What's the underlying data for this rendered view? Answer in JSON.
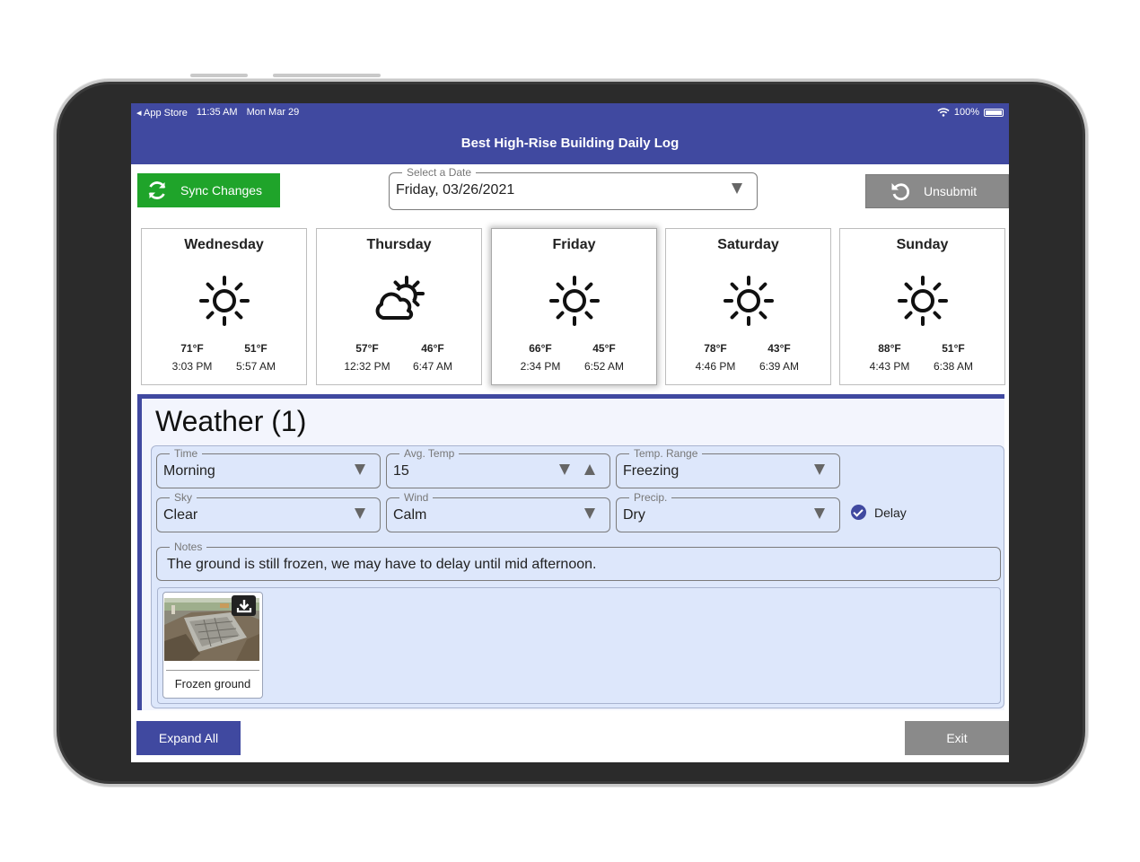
{
  "status_bar": {
    "back_app": "App Store",
    "time": "11:35 AM",
    "date": "Mon Mar 29",
    "battery": "100%"
  },
  "header": {
    "title": "Best High-Rise Building Daily Log"
  },
  "toolbar": {
    "sync_label": "Sync Changes",
    "unsubmit_label": "Unsubmit",
    "date_select": {
      "label": "Select a Date",
      "value": "Friday, 03/26/2021"
    }
  },
  "days": [
    {
      "name": "Wednesday",
      "icon": "sun-icon",
      "high": "71°F",
      "high_time": "3:03 PM",
      "low": "51°F",
      "low_time": "5:57 AM",
      "selected": false
    },
    {
      "name": "Thursday",
      "icon": "partly-cloudy-icon",
      "high": "57°F",
      "high_time": "12:32 PM",
      "low": "46°F",
      "low_time": "6:47 AM",
      "selected": false
    },
    {
      "name": "Friday",
      "icon": "sun-icon",
      "high": "66°F",
      "high_time": "2:34 PM",
      "low": "45°F",
      "low_time": "6:52 AM",
      "selected": true
    },
    {
      "name": "Saturday",
      "icon": "sun-icon",
      "high": "78°F",
      "high_time": "4:46 PM",
      "low": "43°F",
      "low_time": "6:39 AM",
      "selected": false
    },
    {
      "name": "Sunday",
      "icon": "sun-icon",
      "high": "88°F",
      "high_time": "4:43 PM",
      "low": "51°F",
      "low_time": "6:38 AM",
      "selected": false
    }
  ],
  "weather": {
    "title": "Weather (1)",
    "fields": {
      "time": {
        "label": "Time",
        "value": "Morning"
      },
      "avg_temp": {
        "label": "Avg. Temp",
        "value": "15"
      },
      "temp_range": {
        "label": "Temp. Range",
        "value": "Freezing"
      },
      "sky": {
        "label": "Sky",
        "value": "Clear"
      },
      "wind": {
        "label": "Wind",
        "value": "Calm"
      },
      "precip": {
        "label": "Precip.",
        "value": "Dry"
      }
    },
    "delay": {
      "label": "Delay",
      "checked": true
    },
    "notes": {
      "label": "Notes",
      "value": "The ground is still frozen, we may have to delay until mid afternoon."
    },
    "attachments": [
      {
        "caption": "Frozen ground",
        "icon": "download-icon"
      }
    ]
  },
  "footer": {
    "expand_label": "Expand All",
    "exit_label": "Exit"
  },
  "colors": {
    "brand": "#4049a0",
    "sync": "#1fa42a",
    "neutral_button": "#8a8a8a",
    "panel": "#dde7fb"
  }
}
